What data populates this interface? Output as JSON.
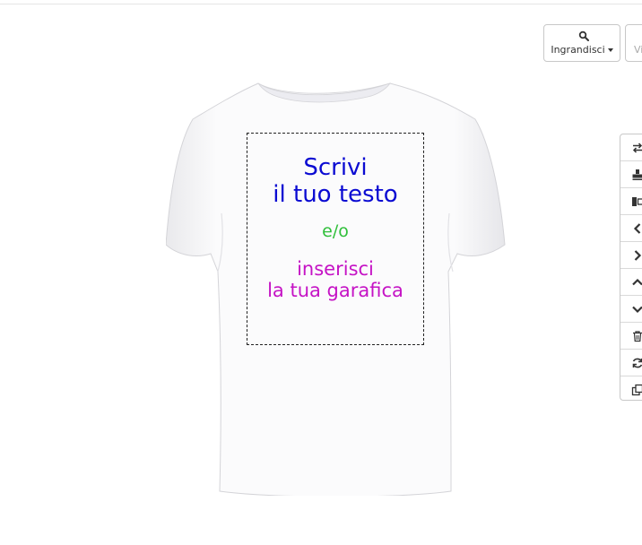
{
  "zoom_button": {
    "label": "Ingrandisci",
    "icon": "search-icon"
  },
  "view_button": {
    "label": "Vi"
  },
  "product": {
    "name": "t-shirt",
    "color": "#ffffff"
  },
  "print_area": {
    "line1": "Scrivi",
    "line2": "il tuo testo",
    "line3": "e/o",
    "line4": "inserisci",
    "line5": "la tua garafica",
    "colors": {
      "blue": "#0a0ad2",
      "green": "#2fbf3a",
      "magenta": "#c513c5"
    }
  },
  "toolbar": {
    "tools": [
      {
        "icon": "swap-icon"
      },
      {
        "icon": "stamp-icon"
      },
      {
        "icon": "align-icon"
      },
      {
        "icon": "chevron-left-icon"
      },
      {
        "icon": "chevron-right-icon"
      },
      {
        "icon": "chevron-up-icon"
      },
      {
        "icon": "chevron-down-icon"
      },
      {
        "icon": "trash-icon"
      },
      {
        "icon": "refresh-icon"
      },
      {
        "icon": "copy-icon"
      }
    ]
  }
}
